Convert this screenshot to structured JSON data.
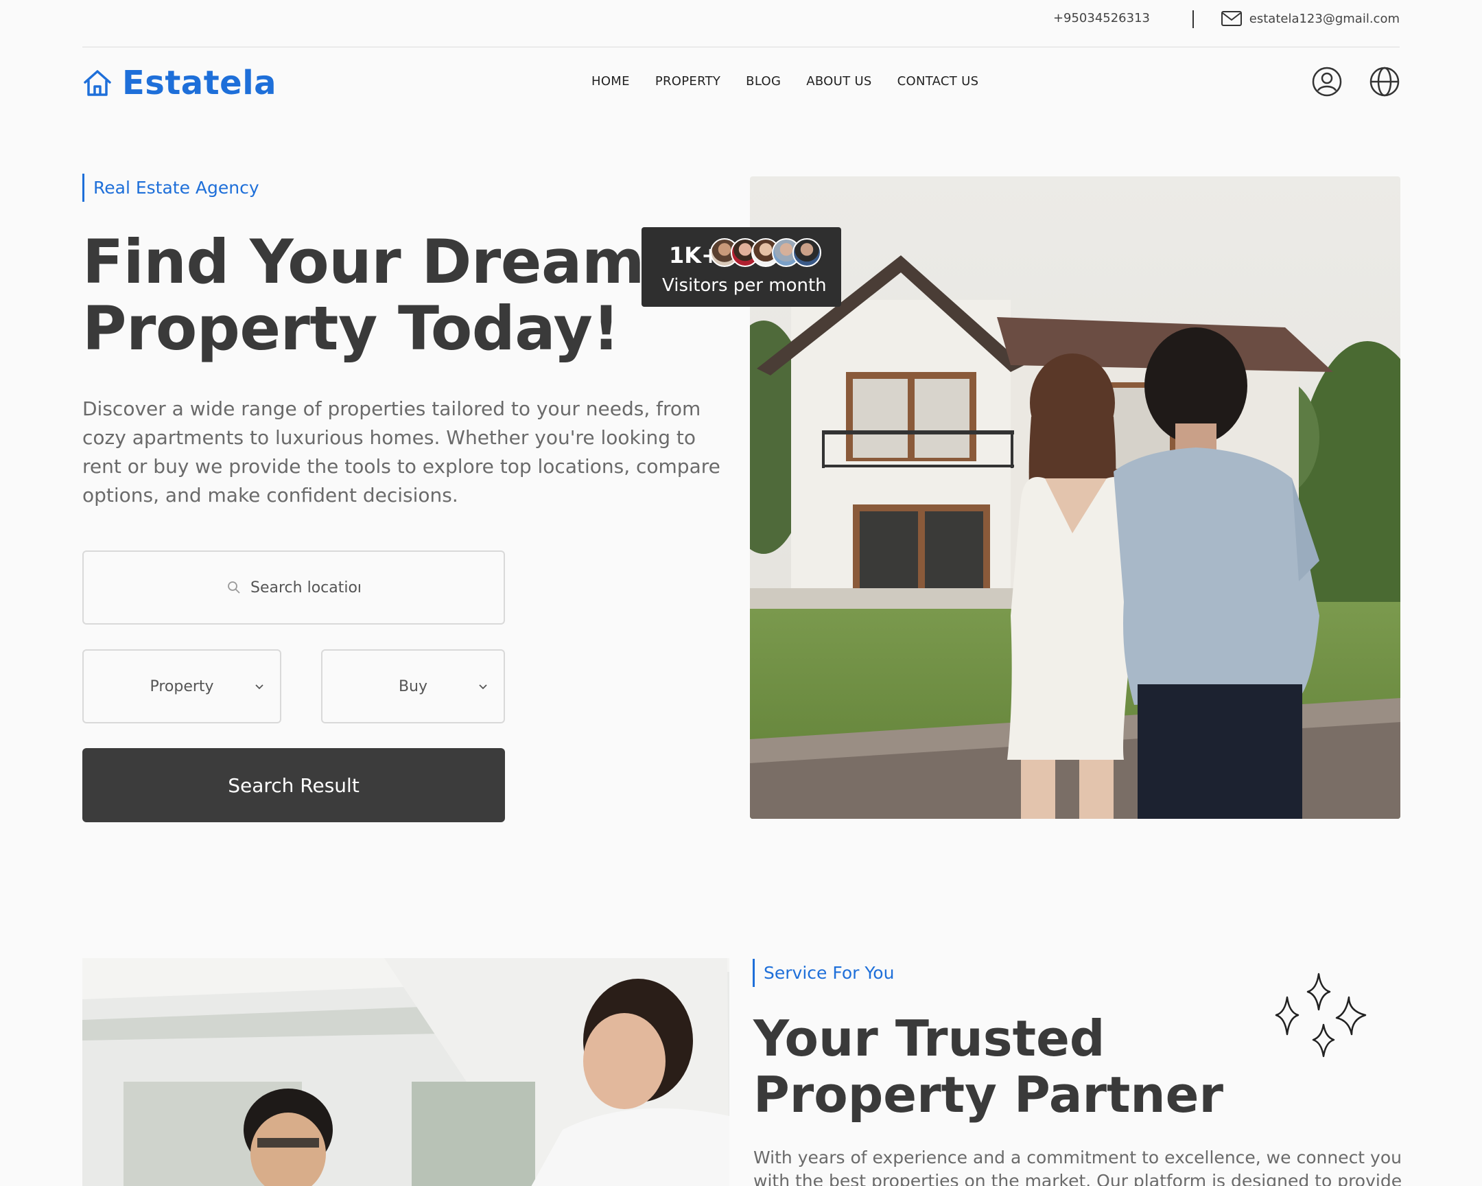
{
  "topbar": {
    "phone": "+95034526313",
    "email": "estatela123@gmail.com"
  },
  "nav": {
    "logo_text": "Estatela",
    "items": [
      "HOME",
      "PROPERTY",
      "BLOG",
      "ABOUT US",
      "CONTACT US"
    ],
    "icons": [
      "user-icon",
      "globe-icon"
    ]
  },
  "hero": {
    "eyebrow": "Real Estate Agency",
    "title_line1": "Find Your Dream",
    "title_line2": "Property Today!",
    "description": "Discover a wide range of properties tailored to your needs, from cozy apartments to luxurious homes. Whether you're looking to rent or buy we provide the tools to explore top locations, compare options, and make confident decisions.",
    "search_placeholder": "Search location",
    "property_select": "Property",
    "mode_select": "Buy",
    "button_label": "Search Result",
    "visitors_count": "1K+",
    "visitors_label": "Visitors per month"
  },
  "service": {
    "eyebrow": "Service For You",
    "title_line1": "Your Trusted",
    "title_line2": "Property Partner",
    "description": "With years of experience and a commitment to excellence, we connect you with the best properties on the market. Our platform is designed to provide"
  },
  "colors": {
    "accent": "#1e6fd9",
    "dark_button": "#3c3c3c",
    "badge_bg": "#2f2f2f",
    "background": "#fafafa"
  }
}
